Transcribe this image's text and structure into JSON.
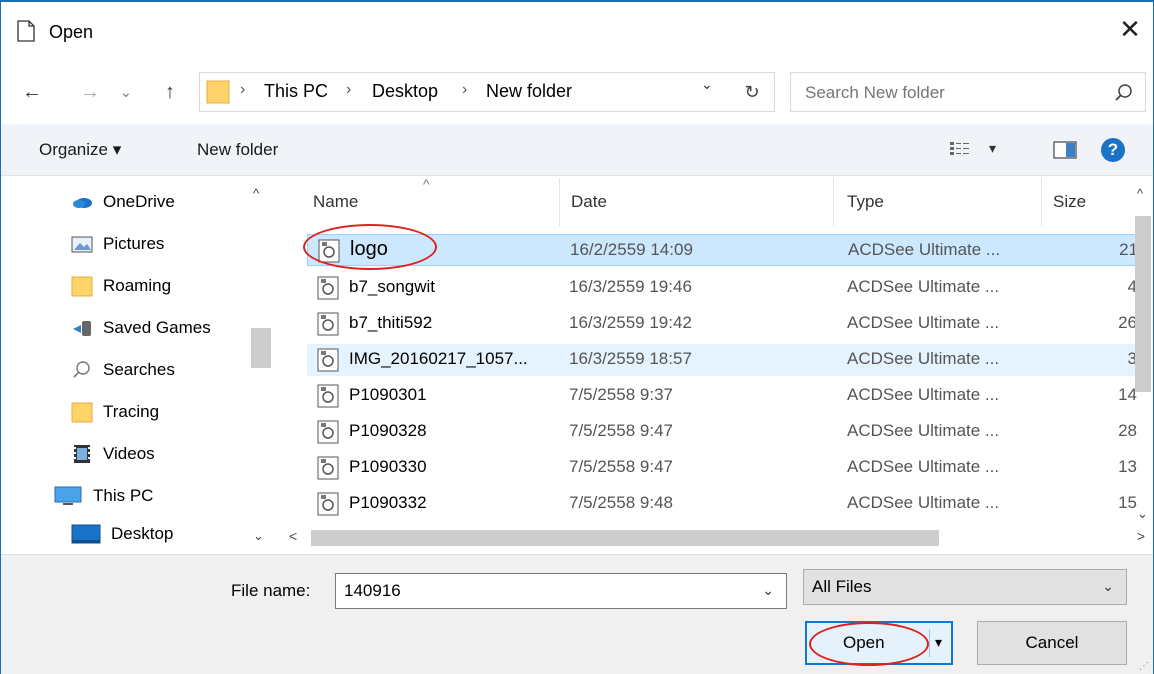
{
  "window": {
    "title": "Open",
    "close_glyph": "✕"
  },
  "nav": {
    "back_glyph": "←",
    "forward_glyph": "→",
    "history_glyph": "⌄",
    "up_glyph": "↑",
    "breadcrumbs": [
      "This PC",
      "Desktop",
      "New folder"
    ],
    "separator_glyph": "›",
    "dropdown_glyph": "⌄",
    "refresh_glyph": "↻",
    "search_placeholder": "Search New folder"
  },
  "toolbar": {
    "organize_label": "Organize ▾",
    "new_folder_label": "New folder",
    "view_glyph": "▾",
    "help_label": "?"
  },
  "sidebar": {
    "items": [
      {
        "label": "OneDrive",
        "icon": "onedrive-icon"
      },
      {
        "label": "Pictures",
        "icon": "pictures-icon"
      },
      {
        "label": "Roaming",
        "icon": "folder-icon"
      },
      {
        "label": "Saved Games",
        "icon": "saved-games-icon"
      },
      {
        "label": "Searches",
        "icon": "search-icon"
      },
      {
        "label": "Tracing",
        "icon": "folder-icon"
      },
      {
        "label": "Videos",
        "icon": "videos-icon"
      },
      {
        "label": "This PC",
        "icon": "computer-icon"
      },
      {
        "label": "Desktop",
        "icon": "desktop-icon"
      }
    ]
  },
  "file_list": {
    "columns": [
      "Name",
      "Date",
      "Type",
      "Size"
    ],
    "sort_glyph": "^",
    "rows": [
      {
        "name": "logo",
        "date": "16/2/2559 14:09",
        "type": "ACDSee Ultimate ...",
        "size": "21"
      },
      {
        "name": "b7_songwit",
        "date": "16/3/2559 19:46",
        "type": "ACDSee Ultimate ...",
        "size": "4"
      },
      {
        "name": "b7_thiti592",
        "date": "16/3/2559 19:42",
        "type": "ACDSee Ultimate ...",
        "size": "26"
      },
      {
        "name": "IMG_20160217_1057...",
        "date": "16/3/2559 18:57",
        "type": "ACDSee Ultimate ...",
        "size": "3"
      },
      {
        "name": "P1090301",
        "date": "7/5/2558 9:37",
        "type": "ACDSee Ultimate ...",
        "size": "14"
      },
      {
        "name": "P1090328",
        "date": "7/5/2558 9:47",
        "type": "ACDSee Ultimate ...",
        "size": "28"
      },
      {
        "name": "P1090330",
        "date": "7/5/2558 9:47",
        "type": "ACDSee Ultimate ...",
        "size": "13"
      },
      {
        "name": "P1090332",
        "date": "7/5/2558 9:48",
        "type": "ACDSee Ultimate ...",
        "size": "15"
      }
    ],
    "selected_index": 0,
    "hover_index": 3
  },
  "footer": {
    "file_name_label": "File name:",
    "file_name_value": "140916",
    "filter_value": "All Files",
    "open_label": "Open",
    "cancel_label": "Cancel",
    "dropdown_glyph": "⌄",
    "split_glyph": "▾"
  },
  "colors": {
    "accent": "#0a78d7",
    "selection": "#cce8ff",
    "annotation": "#e0201b"
  }
}
